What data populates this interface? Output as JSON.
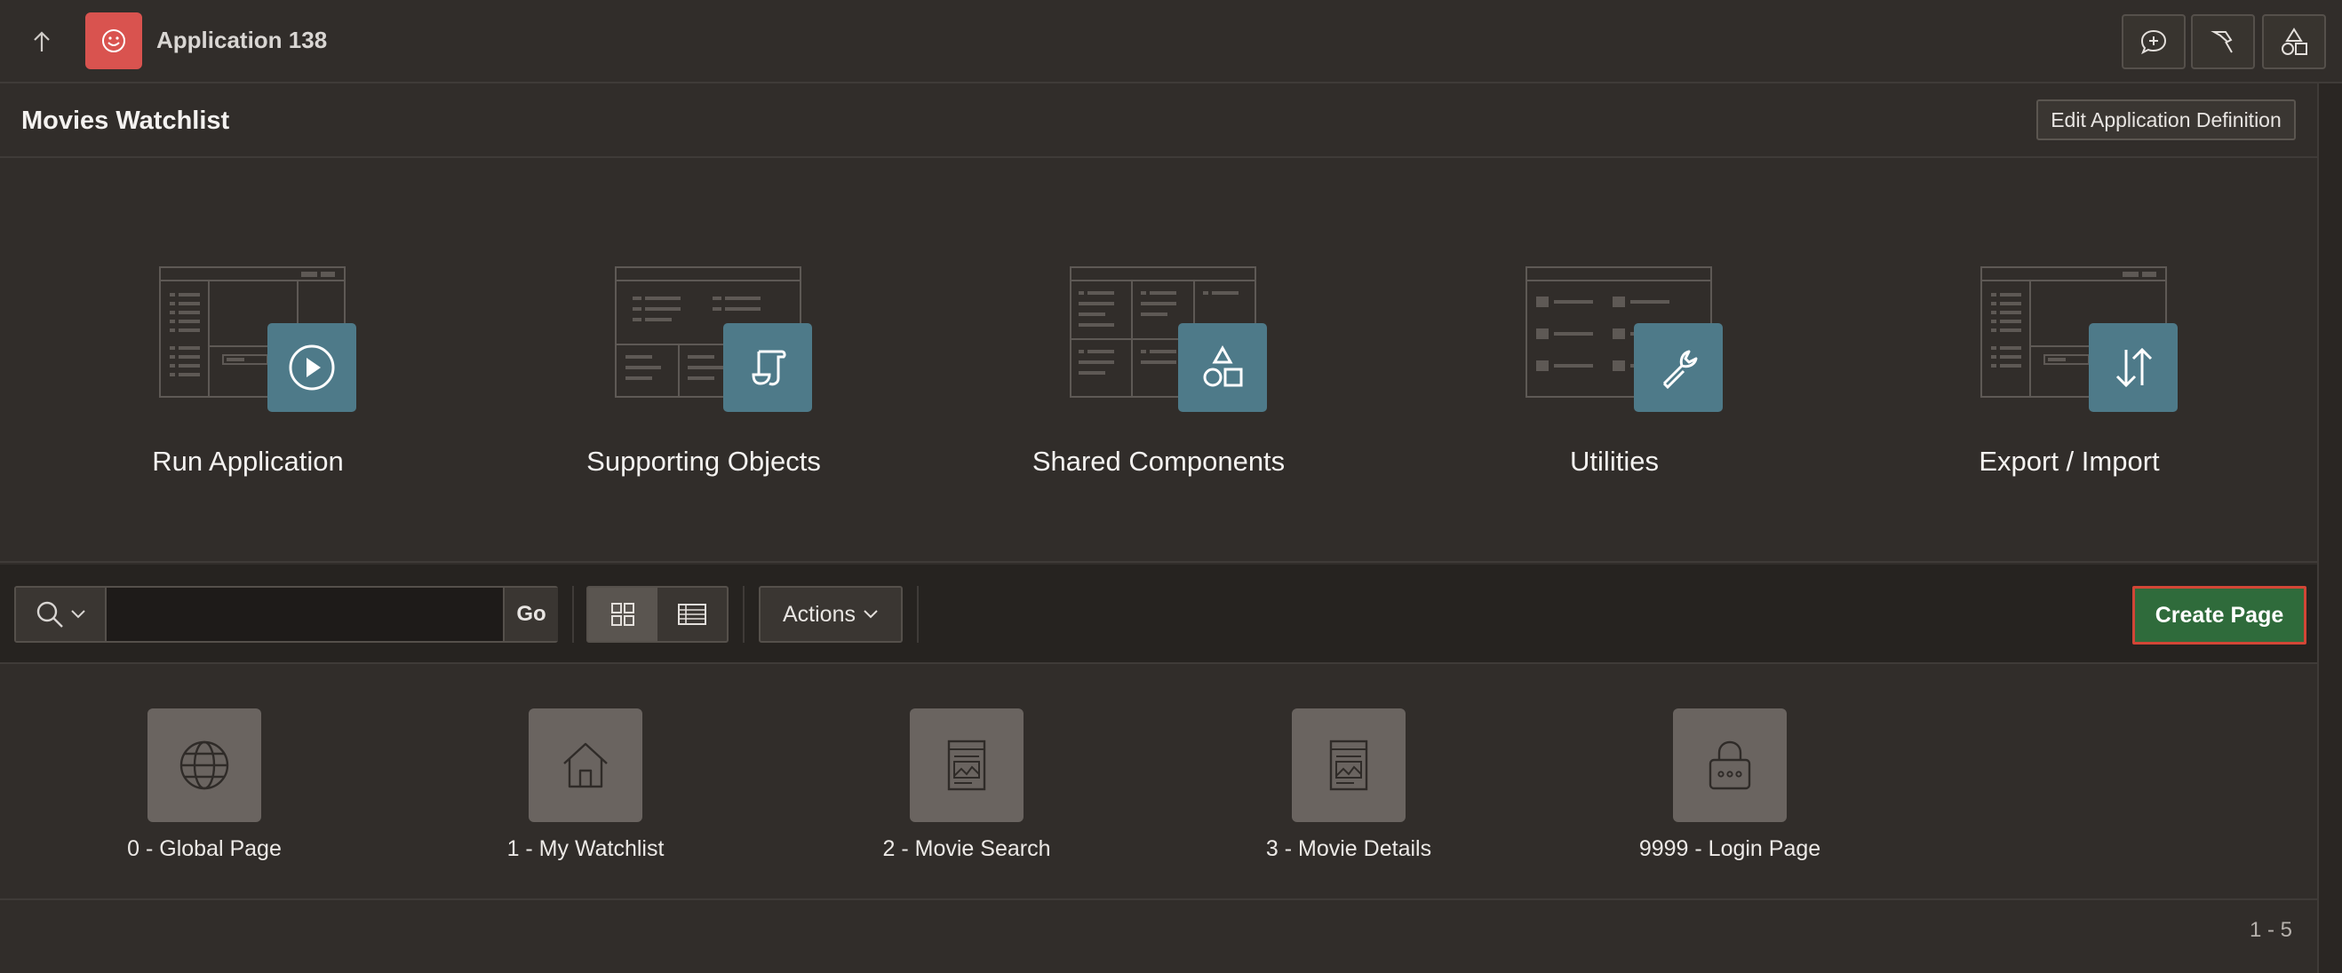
{
  "app": {
    "title": "Application 138"
  },
  "topbar": {
    "buttons": [
      "comment-add-icon",
      "pin-icon",
      "shapes-icon"
    ]
  },
  "region": {
    "title": "Movies Watchlist",
    "edit_label": "Edit Application Definition"
  },
  "hero_tiles": [
    {
      "label": "Run Application",
      "icon": "play-icon"
    },
    {
      "label": "Supporting Objects",
      "icon": "scroll-icon"
    },
    {
      "label": "Shared Components",
      "icon": "shapes-icon"
    },
    {
      "label": "Utilities",
      "icon": "wrench-icon"
    },
    {
      "label": "Export / Import",
      "icon": "transfer-arrows-icon"
    }
  ],
  "toolbar": {
    "search_value": "",
    "go_label": "Go",
    "actions_label": "Actions",
    "create_label": "Create Page",
    "active_view": "grid"
  },
  "pages": [
    {
      "label": "0 - Global Page",
      "icon": "globe-icon"
    },
    {
      "label": "1 - My Watchlist",
      "icon": "home-icon"
    },
    {
      "label": "2 - Movie Search",
      "icon": "form-page-icon"
    },
    {
      "label": "3 - Movie Details",
      "icon": "form-page-icon"
    },
    {
      "label": "9999 - Login Page",
      "icon": "lock-icon"
    }
  ],
  "pagination": "1 - 5",
  "colors": {
    "badge": "#4e7a89",
    "create": "#2f6b3b",
    "highlight": "#d24636",
    "app_icon": "#d9534f"
  }
}
